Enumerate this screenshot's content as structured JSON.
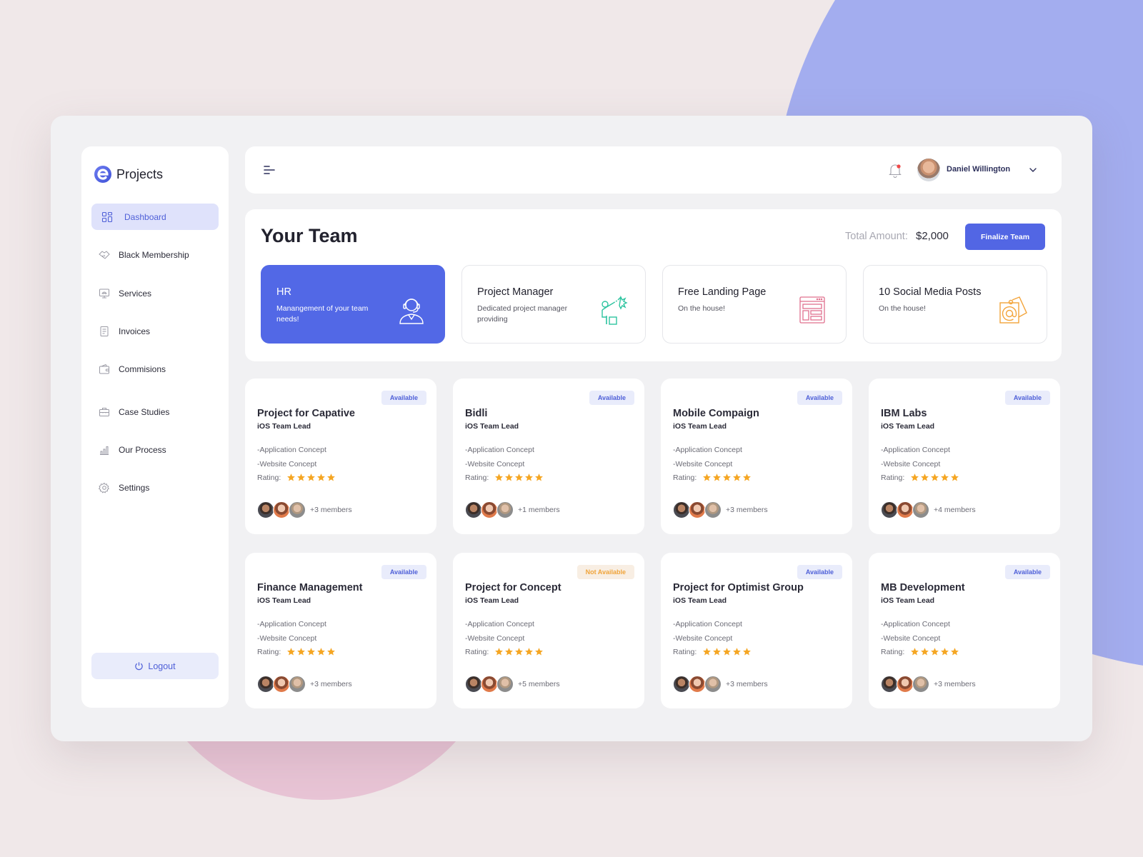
{
  "app": {
    "title": "Projects",
    "brand_color": "#5266e4"
  },
  "sidebar": {
    "items": [
      {
        "label": "Dashboard",
        "icon": "grid-icon",
        "active": true
      },
      {
        "label": "Black  Membership",
        "icon": "handshake-icon",
        "active": false
      },
      {
        "label": "Services",
        "icon": "monitor-icon",
        "active": false
      },
      {
        "label": "Invoices",
        "icon": "document-icon",
        "active": false
      },
      {
        "label": "Commisions",
        "icon": "wallet-icon",
        "active": false
      },
      {
        "label": "Case Studies",
        "icon": "briefcase-icon",
        "active": false
      },
      {
        "label": "Our Process",
        "icon": "chart-icon",
        "active": false
      },
      {
        "label": "Settings",
        "icon": "gear-icon",
        "active": false
      }
    ],
    "logout_label": "Logout"
  },
  "topbar": {
    "menu_icon": "menu-icon",
    "notification_icon": "bell-icon",
    "has_notification": true,
    "user_name": "Daniel Willington"
  },
  "team": {
    "title": "Your Team",
    "total_label": "Total Amount:",
    "total_value": "$2,000",
    "finalize_label": "Finalize Team",
    "services": [
      {
        "title": "HR",
        "desc": "Manangement of your team needs!",
        "icon": "support-agent-icon",
        "selected": true
      },
      {
        "title": "Project Manager",
        "desc": "Dedicated project manager providing",
        "icon": "presenter-icon",
        "selected": false
      },
      {
        "title": "Free Landing Page",
        "desc": "On the house!",
        "icon": "webpage-layout-icon",
        "selected": false
      },
      {
        "title": "10 Social Media Posts",
        "desc": "On the house!",
        "icon": "email-at-icon",
        "selected": false
      }
    ]
  },
  "projects": [
    {
      "title": "Project for Capative",
      "role": "iOS Team Lead",
      "features": [
        "-Application Concept",
        "-Website Concept"
      ],
      "rating_label": "Rating:",
      "rating": 5,
      "status": "Available",
      "members": "+3 members"
    },
    {
      "title": "Bidli",
      "role": "iOS Team Lead",
      "features": [
        "-Application Concept",
        "-Website Concept"
      ],
      "rating_label": "Rating:",
      "rating": 5,
      "status": "Available",
      "members": "+1 members"
    },
    {
      "title": "Mobile Compaign",
      "role": "iOS Team Lead",
      "features": [
        "-Application Concept",
        "-Website Concept"
      ],
      "rating_label": "Rating:",
      "rating": 5,
      "status": "Available",
      "members": "+3 members"
    },
    {
      "title": "IBM Labs",
      "role": "iOS Team Lead",
      "features": [
        "-Application Concept",
        "-Website Concept"
      ],
      "rating_label": "Rating:",
      "rating": 5,
      "status": "Available",
      "members": "+4 members"
    },
    {
      "title": "Finance Management",
      "role": "iOS Team Lead",
      "features": [
        "-Application Concept",
        "-Website Concept"
      ],
      "rating_label": "Rating:",
      "rating": 5,
      "status": "Available",
      "members": "+3 members"
    },
    {
      "title": "Project for Concept",
      "role": "iOS Team Lead",
      "features": [
        "-Application Concept",
        "-Website Concept"
      ],
      "rating_label": "Rating:",
      "rating": 5,
      "status": "Not Available",
      "members": "+5 members"
    },
    {
      "title": "Project for Optimist Group",
      "role": "iOS Team Lead",
      "features": [
        "-Application Concept",
        "-Website Concept"
      ],
      "rating_label": "Rating:",
      "rating": 5,
      "status": "Available",
      "members": "+3 members"
    },
    {
      "title": "MB Development",
      "role": "iOS Team Lead",
      "features": [
        "-Application Concept",
        "-Website Concept"
      ],
      "rating_label": "Rating:",
      "rating": 5,
      "status": "Available",
      "members": "+3 members"
    }
  ],
  "colors": {
    "accent": "#5266e4",
    "available_badge_text": "#4f60d8",
    "unavailable_badge_text": "#f0a43a",
    "star": "#f5a623"
  }
}
